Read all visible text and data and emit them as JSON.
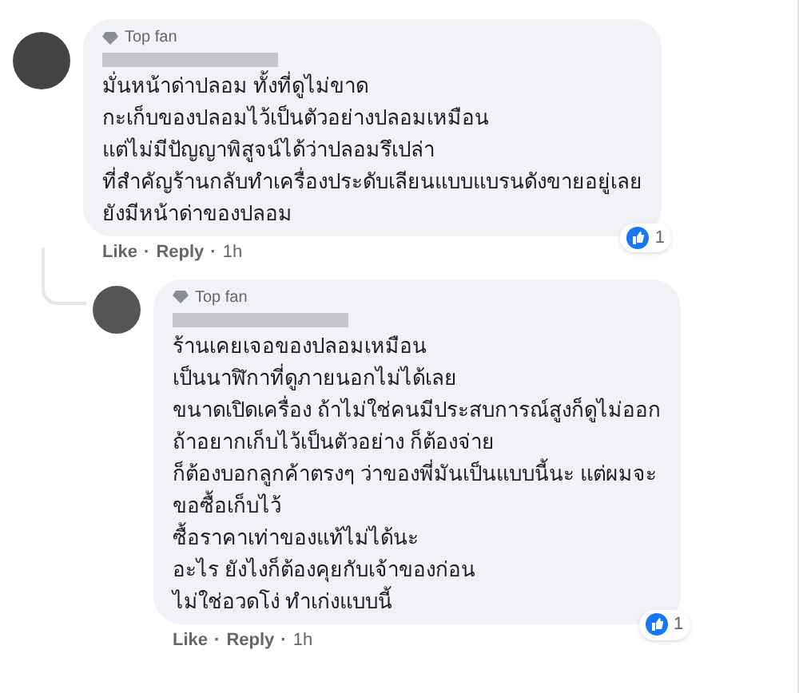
{
  "comments": [
    {
      "badge": "Top fan",
      "lines": [
        "มั่นหน้าด่าปลอม ทั้งที่ดูไม่ขาด",
        "กะเก็บของปลอมไว้เป็นตัวอย่างปลอมเหมือน",
        "แต่ไม่มีปัญญาพิสูจน์ได้ว่าปลอมรึเปล่า",
        "ที่สำคัญร้านกลับทำเครื่องประดับเลียนแบบแบรนดังขายอยู่เลย",
        "ยังมีหน้าด่าของปลอม"
      ],
      "reaction_count": "1",
      "actions": [
        "Like",
        "Reply",
        "1h"
      ],
      "separator": "·",
      "replies": [
        {
          "badge": "Top fan",
          "lines": [
            "ร้านเคยเจอของปลอมเหมือน",
            "เป็นนาฬิกาที่ดูภายนอกไม่ได้เลย",
            "ขนาดเปิดเครื่อง ถ้าไม่ใช่คนมีประสบการณ์สูงก็ดูไม่ออก",
            "ถ้าอยากเก็บไว้เป็นตัวอย่าง ก็ต้องจ่าย",
            "ก็ต้องบอกลูกค้าตรงๆ ว่าของพี่มันเป็นแบบนี้นะ แต่ผมจะ",
            "ขอซื้อเก็บไว้",
            "ซื้อราคาเท่าของแท้ไม่ได้นะ",
            "อะไร ยังไงก็ต้องคุยกับเจ้าของก่อน",
            "ไม่ใช่อวดโง่ ทำเก่งแบบนี้"
          ],
          "reaction_count": "1",
          "actions": [
            "Like",
            "Reply",
            "1h"
          ],
          "separator": "·"
        }
      ]
    }
  ]
}
